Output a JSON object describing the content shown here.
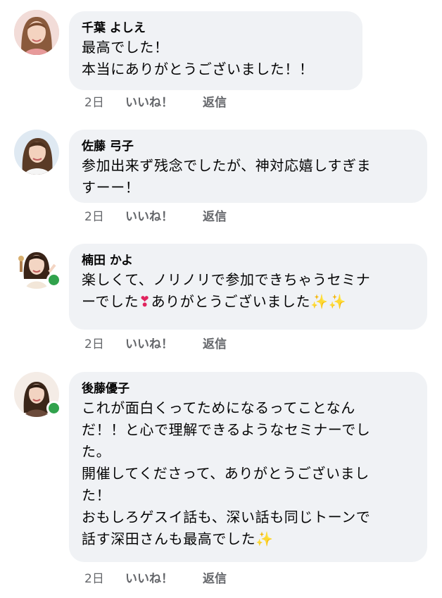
{
  "comments": [
    {
      "author": "千葉 よしえ",
      "lines": [
        "最高でした！",
        "本当にありがとうございました！！"
      ],
      "time": "2日",
      "like_label": "いいね！",
      "reply_label": "返信",
      "online": false
    },
    {
      "author": "佐藤 弓子",
      "lines": [
        "参加出来ず残念でしたが、神対応嬉しすぎま",
        "すーー！"
      ],
      "time": "2日",
      "like_label": "いいね！",
      "reply_label": "返信",
      "online": false
    },
    {
      "author": "楠田 かよ",
      "lines": [
        "楽しくて、ノリノリで参加できちゃうセミナ",
        "ーでした",
        "ありがとうございました"
      ],
      "time": "2日",
      "like_label": "いいね！",
      "reply_label": "返信",
      "online": true
    },
    {
      "author": "後藤優子",
      "lines": [
        "これが面白くってためになるってことなん",
        "だ！！と心で理解できるようなセミナーでし",
        "た。",
        "開催してくださって、ありがとうございまし",
        "た！",
        "おもしろゲスイ話も、深い話も同じトーンで",
        "話す深田さんも最高でした"
      ],
      "time": "2日",
      "like_label": "いいね！",
      "reply_label": "返信",
      "online": true
    }
  ],
  "icons": {
    "heart": "❣",
    "sparkles": "✨"
  },
  "colors": {
    "bubble": "#f0f2f5",
    "meta_text": "#65676b",
    "online": "#31a24c"
  }
}
